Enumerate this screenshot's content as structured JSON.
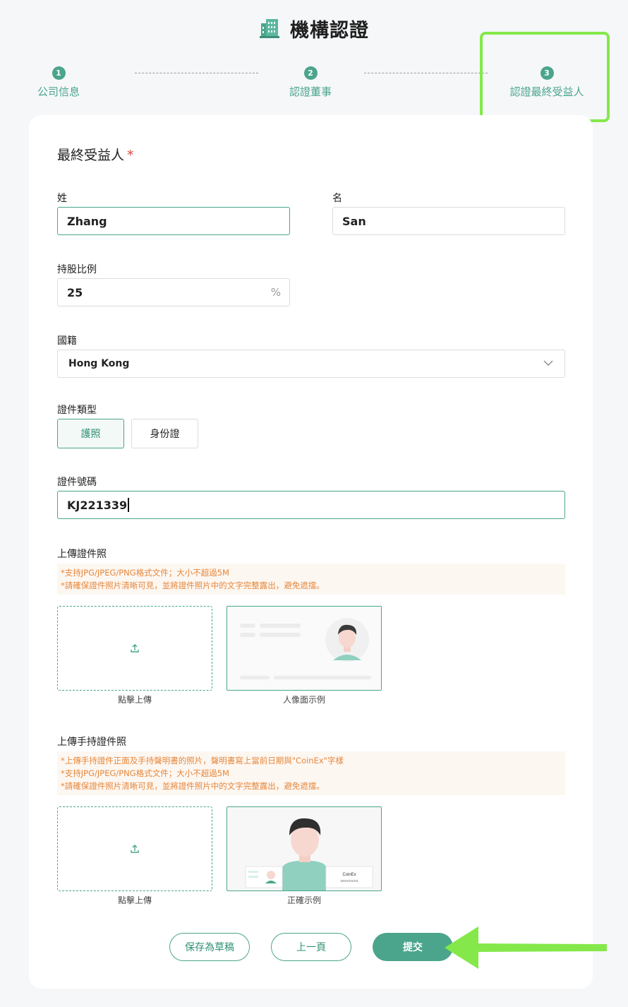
{
  "header": {
    "title": "機構認證"
  },
  "steps": [
    {
      "num": "1",
      "label": "公司信息"
    },
    {
      "num": "2",
      "label": "認證董事"
    },
    {
      "num": "3",
      "label": "認證最終受益人"
    }
  ],
  "form": {
    "section_title": "最終受益人",
    "required_mark": "*",
    "surname": {
      "label": "姓",
      "value": "Zhang"
    },
    "given_name": {
      "label": "名",
      "value": "San"
    },
    "shareholding": {
      "label": "持股比例",
      "value": "25",
      "suffix": "%"
    },
    "nationality": {
      "label": "國籍",
      "value": "Hong Kong"
    },
    "id_type": {
      "label": "證件類型",
      "options": [
        "護照",
        "身份證"
      ],
      "selected": "護照"
    },
    "id_number": {
      "label": "證件號碼",
      "value": "KJ221339"
    },
    "upload_id": {
      "label": "上傳證件照",
      "notes": [
        "*支持JPG/JPEG/PNG格式文件；大小不超過5M",
        "*請確保證件照片清晰可見，並將證件照片中的文字完整露出，避免遮擋。"
      ],
      "upload_caption": "點擊上傳",
      "sample_caption": "人像面示例"
    },
    "upload_handheld": {
      "label": "上傳手持證件照",
      "notes": [
        "*上傳手持證件正面及手持聲明書的照片，聲明書寫上當前日期與\"CoinEx\"字樣",
        "*支持JPG/JPEG/PNG格式文件；大小不超過5M",
        "*請確保證件照片清晰可見，並將證件照片中的文字完整露出，避免遮擋。"
      ],
      "upload_caption": "點擊上傳",
      "sample_caption": "正確示例",
      "sample_note_brand": "CoinEx",
      "sample_note_date": "20XX/XX/XX"
    }
  },
  "buttons": {
    "save_draft": "保存為草稿",
    "previous": "上一頁",
    "submit": "提交"
  },
  "colors": {
    "accent": "#4aa58c",
    "highlight": "#84e84a",
    "warning": "#e5873a"
  },
  "icons": {
    "logo": "building-icon",
    "upload": "upload-icon",
    "dropdown": "chevron-down-icon"
  }
}
